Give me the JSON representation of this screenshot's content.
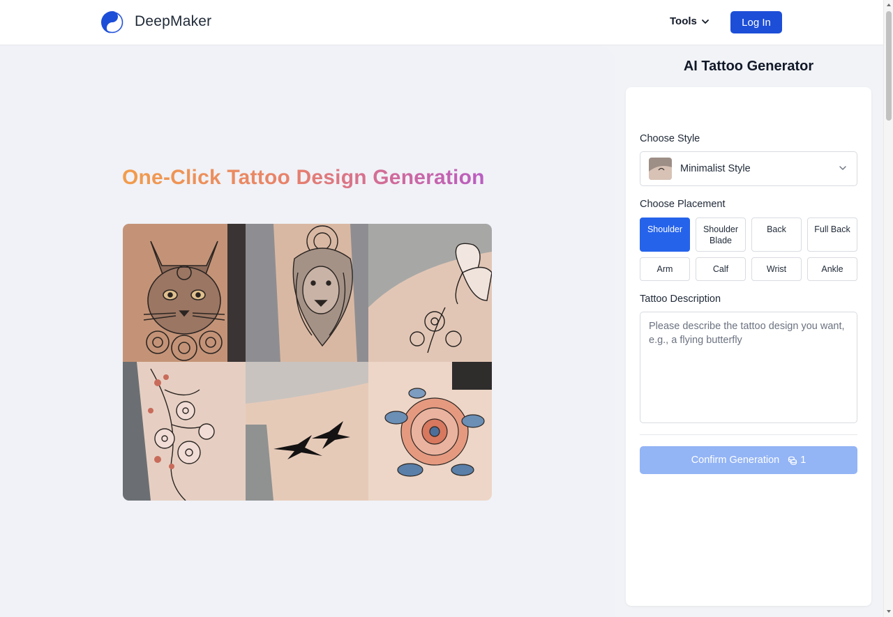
{
  "header": {
    "brand": "DeepMaker",
    "tools_label": "Tools",
    "login_label": "Log In"
  },
  "hero": {
    "title": "One-Click Tattoo Design Generation",
    "gallery": [
      "cat-tattoo",
      "lion-tattoo",
      "butterfly-tattoo",
      "cherry-blossom-tattoo",
      "swallows-tattoo",
      "peony-tattoo"
    ]
  },
  "panel": {
    "title": "AI Tattoo Generator",
    "style_label": "Choose Style",
    "style_value": "Minimalist Style",
    "placement_label": "Choose Placement",
    "placements": [
      {
        "label": "Shoulder",
        "active": true
      },
      {
        "label": "Shoulder Blade",
        "active": false
      },
      {
        "label": "Back",
        "active": false
      },
      {
        "label": "Full Back",
        "active": false
      },
      {
        "label": "Arm",
        "active": false
      },
      {
        "label": "Calf",
        "active": false
      },
      {
        "label": "Wrist",
        "active": false
      },
      {
        "label": "Ankle",
        "active": false
      }
    ],
    "description_label": "Tattoo Description",
    "description_placeholder": "Please describe the tattoo design you want, e.g., a flying butterfly",
    "description_value": "",
    "confirm_label": "Confirm Generation",
    "credit_cost": "1"
  },
  "colors": {
    "primary": "#1d4ed8",
    "active_button": "#2563eb",
    "confirm_disabled": "#93b4f5",
    "gradient_start": "#f29d4b",
    "gradient_end": "#b95dc2"
  }
}
